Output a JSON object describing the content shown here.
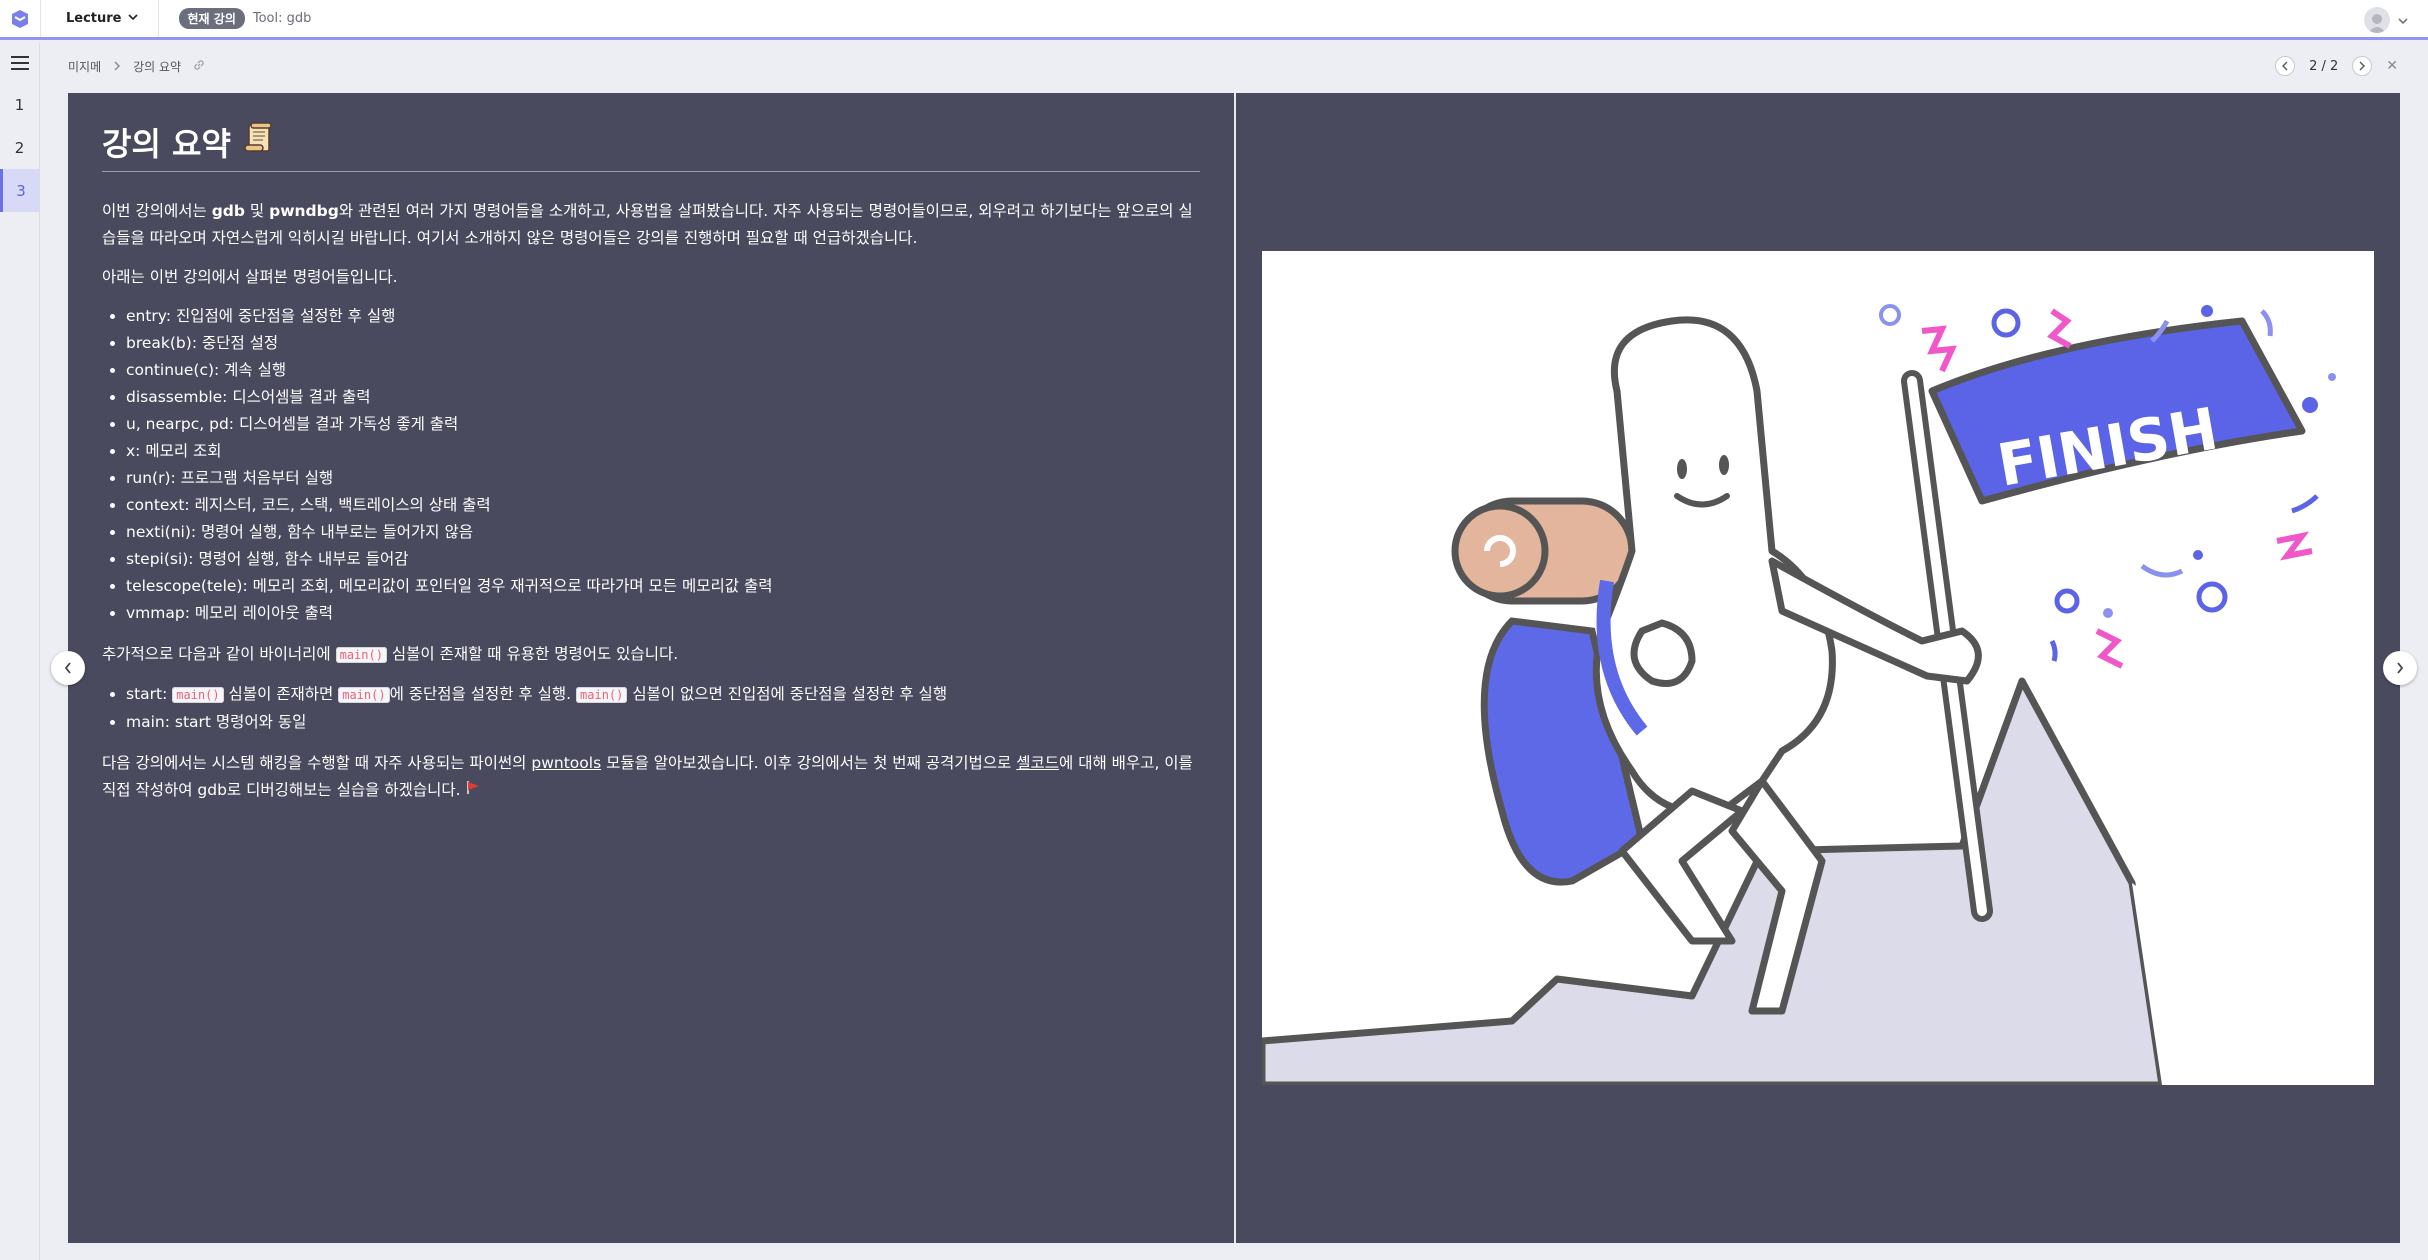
{
  "topbar": {
    "lecture_label": "Lecture",
    "badge": "현재 강의",
    "tool": "Tool: gdb"
  },
  "rail": {
    "items": [
      "1",
      "2",
      "3"
    ],
    "active": "3"
  },
  "breadcrumb": {
    "parent": "미지메",
    "current": "강의 요약"
  },
  "pager": {
    "label": "2 / 2"
  },
  "slide": {
    "title": "강의 요약",
    "intro": {
      "t1": "이번 강의에서는 ",
      "b1": "gdb",
      "t2": " 및 ",
      "b2": "pwndbg",
      "t3": "와 관련된 여러 가지 명령어들을 소개하고, 사용법을 살펴봤습니다. 자주 사용되는 명령어들이므로, 외우려고 하기보다는 앞으로의 실습들을 따라오며 자연스럽게 익히시길 바랍니다. 여기서 소개하지 않은 명령어들은 강의를 진행하며 필요할 때 언급하겠습니다."
    },
    "list_intro": "아래는 이번 강의에서 살펴본 명령어들입니다.",
    "commands": [
      "entry: 진입점에 중단점을 설정한 후 실행",
      "break(b): 중단점 설정",
      "continue(c): 계속 실행",
      "disassemble: 디스어셈블 결과 출력",
      "u, nearpc, pd: 디스어셈블 결과 가독성 좋게 출력",
      "x: 메모리 조회",
      "run(r): 프로그램 처음부터 실행",
      "context: 레지스터, 코드, 스택, 백트레이스의 상태 출력",
      "nexti(ni): 명령어 실행, 함수 내부로는 들어가지 않음",
      "stepi(si): 명령어 실행, 함수 내부로 들어감",
      "telescope(tele): 메모리 조회, 메모리값이 포인터일 경우 재귀적으로 따라가며 모든 메모리값 출력",
      "vmmap: 메모리 레이아웃 출력"
    ],
    "extra": {
      "before": "추가적으로 다음과 같이 바이너리에 ",
      "code": "main()",
      "after": " 심볼이 존재할 때 유용한 명령어도 있습니다."
    },
    "extra_items": {
      "start_label": "start: ",
      "start_code1": "main()",
      "start_t1": " 심볼이 존재하면 ",
      "start_code2": "main()",
      "start_t2": "에 중단점을 설정한 후 실행. ",
      "start_code3": "main()",
      "start_t3": " 심볼이 없으면 진입점에 중단점을 설정한 후 실행",
      "main_item": "main: start 명령어와 동일"
    },
    "outro": {
      "t1": "다음 강의에서는 시스템 해킹을 수행할 때 자주 사용되는 파이썬의 ",
      "link1": "pwntools",
      "t2": " 모듈을 알아보겠습니다. 이후 강의에서는 첫 번째 공격기법으로 ",
      "link2": "셸코드",
      "t3": "에 대해 배우고, 이를 직접 작성하여 gdb로 디버깅해보는 실습을 하겠습니다."
    },
    "illustration": {
      "flag_text": "FINISH",
      "flag_color": "#5b64e6",
      "accent_pink": "#f057c8"
    }
  }
}
